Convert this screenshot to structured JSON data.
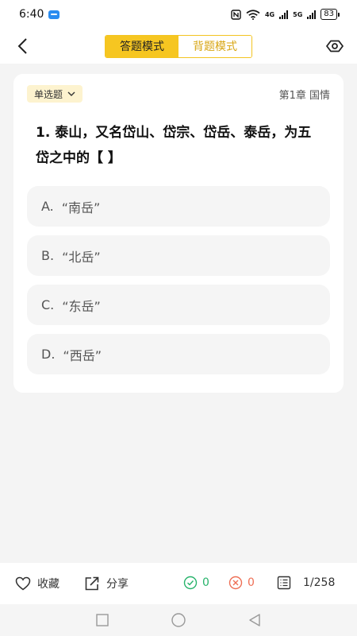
{
  "status_bar": {
    "time": "6:40",
    "net_4g": "4G",
    "net_5g": "5G",
    "battery": "83"
  },
  "header": {
    "tabs": [
      {
        "label": "答题模式",
        "active": true
      },
      {
        "label": "背题模式",
        "active": false
      }
    ]
  },
  "question": {
    "type": "单选题",
    "chapter": "第1章 国情",
    "text": "1. 泰山，又名岱山、岱宗、岱岳、泰岳，为五岱之中的【 】",
    "options": [
      {
        "letter": "A.",
        "text": "“南岳”"
      },
      {
        "letter": "B.",
        "text": "“北岳”"
      },
      {
        "letter": "C.",
        "text": "“东岳”"
      },
      {
        "letter": "D.",
        "text": "“西岳”"
      }
    ]
  },
  "bottom_bar": {
    "favorite": "收藏",
    "share": "分享",
    "correct_count": "0",
    "wrong_count": "0",
    "progress": "1/258"
  },
  "colors": {
    "accent": "#f6c621",
    "correct": "#27b36b",
    "wrong": "#ee6f55"
  }
}
